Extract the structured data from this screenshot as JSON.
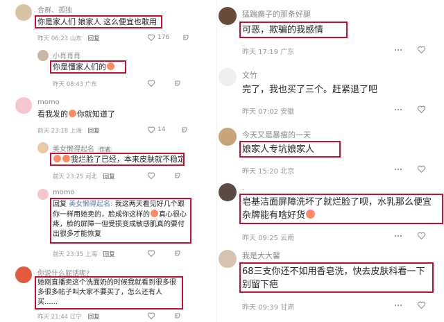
{
  "left": {
    "comments": [
      {
        "user": "合群、孤独",
        "text": "你是家人们 娘家人 这么便宜也敢用",
        "time": "昨天 06:23",
        "loc": "山东",
        "reply": "回复",
        "likes": "176"
      },
      {
        "user": "小肖肖肖",
        "text": "你是懂家人们的",
        "time": "昨天 08:43",
        "loc": "广东",
        "reply": "回复"
      },
      {
        "user": "momo",
        "text": "看我发的",
        "text2": "你就知道了",
        "time": "前天 23:18",
        "loc": "上海",
        "reply": "回复",
        "likes": "14"
      },
      {
        "user": "美女懒得起名",
        "author_tag": "作者",
        "text": "我烂脸了已经，本来皮肤就不稳定",
        "time": "前天 23:25",
        "loc": "河北",
        "reply": "回复"
      },
      {
        "user": "momo",
        "text_reply": "回复",
        "text_quote": "美女懒得起名:",
        "text": "我这两天看见好几个跟你一样用她卖的，脸成你这样的",
        "text_b": "真心很心疼，脸的屏障一但受损变成敏感肌真的要付出很多才能恢复",
        "time": "前天 23:35",
        "loc": "上海",
        "reply": "回复"
      },
      {
        "user": "你说什么屁话呢?",
        "text": "她刚直播卖这个洗面奶的时候我就看到很多很多很多帖子叫大家不要买了，怎么还有人买......",
        "time": "昨天 21:44",
        "loc": "辽宁",
        "reply": "回复"
      }
    ]
  },
  "right": {
    "comments": [
      {
        "user": "猛踹瘸子的那条好腿",
        "text": "可恶，欺骗的我感情",
        "time": "昨天 17:19",
        "loc": "广东"
      },
      {
        "user": "文竹",
        "text": "完了，我也买了三个。赶紧退了吧",
        "time": "昨天 07:02",
        "loc": "安徽"
      },
      {
        "user": "今天又是暴瘦的一天",
        "text": "娘家人专坑娘家人",
        "time": "昨天 15:20",
        "loc": "北京"
      },
      {
        "user": ".",
        "text": "皂基洁面屏障洗坏了就烂脸了呗，水乳那么便宜杂牌能有啥好货",
        "time": "昨天 09:25",
        "loc": "云南"
      },
      {
        "user": "我是大大馨",
        "text": "68三支你还不如用香皂洗，快去皮肤科看一下别留下疤",
        "time": "昨天 09:39",
        "loc": "甘肃"
      }
    ]
  }
}
